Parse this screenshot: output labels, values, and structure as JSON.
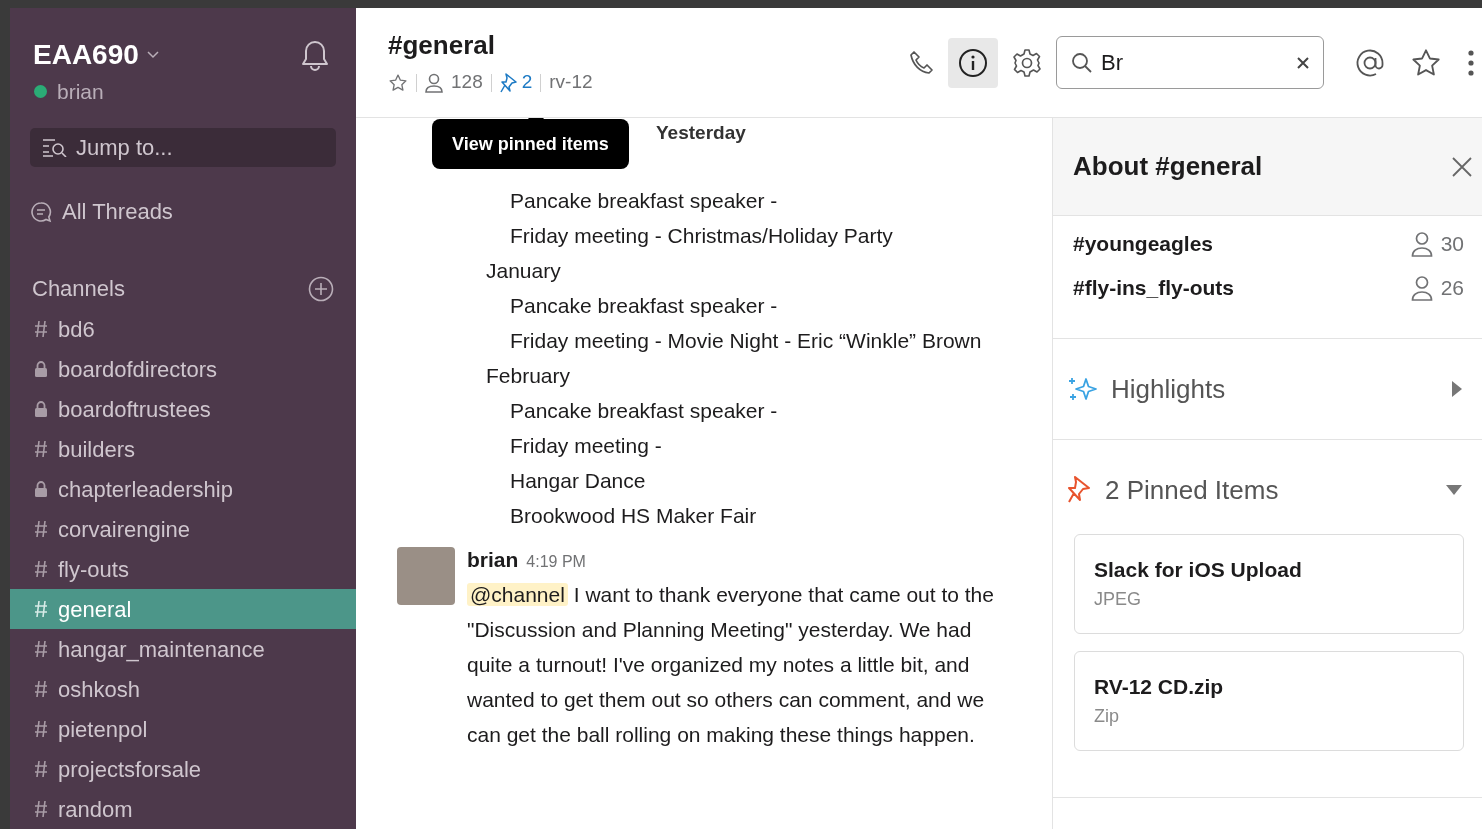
{
  "workspace": {
    "name": "EAA690",
    "user": "brian"
  },
  "sidebar": {
    "jump_to": {
      "placeholder": "Jump to..."
    },
    "all_threads": "All Threads",
    "channels_heading": "Channels",
    "channels": [
      {
        "name": "bd6",
        "kind": "public",
        "selected": false
      },
      {
        "name": "boardofdirectors",
        "kind": "private",
        "selected": false
      },
      {
        "name": "boardoftrustees",
        "kind": "private",
        "selected": false
      },
      {
        "name": "builders",
        "kind": "public",
        "selected": false
      },
      {
        "name": "chapterleadership",
        "kind": "private",
        "selected": false
      },
      {
        "name": "corvairengine",
        "kind": "public",
        "selected": false
      },
      {
        "name": "fly-outs",
        "kind": "public",
        "selected": false
      },
      {
        "name": "general",
        "kind": "public",
        "selected": true
      },
      {
        "name": "hangar_maintenance",
        "kind": "public",
        "selected": false
      },
      {
        "name": "oshkosh",
        "kind": "public",
        "selected": false
      },
      {
        "name": "pietenpol",
        "kind": "public",
        "selected": false
      },
      {
        "name": "projectsforsale",
        "kind": "public",
        "selected": false
      },
      {
        "name": "random",
        "kind": "public",
        "selected": false
      }
    ]
  },
  "channel_header": {
    "title": "#general",
    "members": "128",
    "pins": "2",
    "topic": "rv-12",
    "info_panel_open": true
  },
  "search": {
    "value": "Br"
  },
  "tooltip": "View pinned items",
  "date_divider": "Yesterday",
  "notes": [
    {
      "children": [
        {
          "text": "Pancake breakfast speaker -"
        },
        {
          "text": "Friday meeting - Christmas/Holiday Party"
        }
      ]
    },
    {
      "text": "January",
      "children": [
        {
          "text": "Pancake breakfast speaker -"
        },
        {
          "text": "Friday meeting - Movie Night - Eric “Winkle” Brown"
        }
      ]
    },
    {
      "text": "February",
      "children": [
        {
          "text": "Pancake breakfast speaker -"
        },
        {
          "text": "Friday meeting -"
        },
        {
          "text": "Hangar Dance"
        },
        {
          "text": "Brookwood HS Maker Fair"
        }
      ]
    }
  ],
  "message": {
    "author": "brian",
    "time": "4:19 PM",
    "mention": "@channel",
    "text": " I want to thank everyone that came out to the \"Discussion and Planning Meeting\" yesterday. We had quite a turnout! I've organized my notes a little bit, and wanted to get them out so others can comment, and we can get the ball rolling on making these things happen."
  },
  "details_panel": {
    "title": "About #general",
    "shared_channels": [
      {
        "name": "#youngeagles",
        "members": "30"
      },
      {
        "name": "#fly-ins_fly-outs",
        "members": "26"
      }
    ],
    "sections": [
      {
        "kind": "highlights",
        "title": "Highlights",
        "expanded": false
      },
      {
        "kind": "pins",
        "title": "2 Pinned Items",
        "expanded": true,
        "items": [
          {
            "title": "Slack for iOS Upload",
            "type": "JPEG"
          },
          {
            "title": "RV-12 CD.zip",
            "type": "Zip"
          }
        ]
      }
    ]
  }
}
